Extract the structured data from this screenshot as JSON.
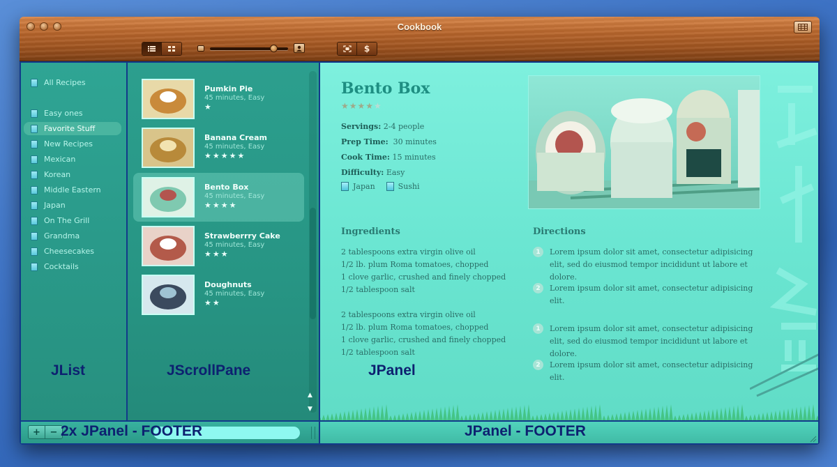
{
  "window": {
    "title": "Cookbook"
  },
  "toolbar": {
    "view_modes": [
      "list-view-icon",
      "grid-view-icon"
    ],
    "zoom_level": 0.82,
    "actions": [
      "fullscreen-icon",
      "dollar-icon"
    ]
  },
  "sidebar": {
    "items": [
      {
        "label": "All Recipes",
        "icon": "book-icon"
      },
      {
        "label": "Easy ones",
        "icon": "smart-folder-icon"
      },
      {
        "label": "Favorite Stuff",
        "icon": "smart-folder-icon",
        "selected": true
      },
      {
        "label": "New Recipes",
        "icon": "smart-folder-icon"
      },
      {
        "label": "Mexican",
        "icon": "folder-icon"
      },
      {
        "label": "Korean",
        "icon": "folder-icon"
      },
      {
        "label": "Middle Eastern",
        "icon": "folder-icon"
      },
      {
        "label": "Japan",
        "icon": "folder-icon"
      },
      {
        "label": "On The Grill",
        "icon": "folder-icon"
      },
      {
        "label": "Grandma",
        "icon": "folder-icon"
      },
      {
        "label": "Cheesecakes",
        "icon": "folder-icon"
      },
      {
        "label": "Cocktails",
        "icon": "folder-icon"
      }
    ]
  },
  "recipes": [
    {
      "name": "Pumkin Pie",
      "meta": "45 minutes, Easy",
      "stars": "★",
      "rating": 1
    },
    {
      "name": "Banana Cream",
      "meta": "45 minutes, Easy",
      "stars": "★★★★★",
      "rating": 5
    },
    {
      "name": "Bento Box",
      "meta": "45 minutes, Easy",
      "stars": "★★★★",
      "rating": 4,
      "selected": true
    },
    {
      "name": "Strawberrry Cake",
      "meta": "45 minutes, Easy",
      "stars": "★★★",
      "rating": 3
    },
    {
      "name": "Doughnuts",
      "meta": "45 minutes, Easy",
      "stars": "★★",
      "rating": 2
    }
  ],
  "labels": {
    "jlist": "JList",
    "jscrollpane": "JScrollPane",
    "jpanel": "JPanel",
    "footer_left": "2x JPanel - FOOTER",
    "footer_right": "JPanel - FOOTER"
  },
  "detail": {
    "title": "Bento Box",
    "stars_on": "★★★★",
    "stars_off": "★",
    "rating": 4,
    "servings_label": "Servings:",
    "servings": "2-4 people",
    "prep_label": "Prep Time:",
    "prep": "30 minutes",
    "cook_label": "Cook Time:",
    "cook": "15 minutes",
    "difficulty_label": "Difficulty:",
    "difficulty": "Easy",
    "tags": [
      "Japan",
      "Sushi"
    ],
    "ingredients_heading": "Ingredients",
    "ingredients": [
      "2 tablespoons extra virgin olive oil",
      "1/2 lb. plum Roma tomatoes, chopped",
      "1 clove garlic, crushed and finely chopped",
      "1/2 tablespoon salt",
      "",
      "2 tablespoons extra virgin olive oil",
      "1/2 lb. plum Roma tomatoes, chopped",
      "1 clove garlic, crushed and finely chopped",
      "1/2 tablespoon salt"
    ],
    "directions_heading": "Directions",
    "directions": [
      {
        "num": "1",
        "text": "Lorem ipsum dolor sit amet, consectetur adipisicing elit, sed do eiusmod tempor incididunt ut labore et dolore."
      },
      {
        "num": "2",
        "text": "Lorem ipsum dolor sit amet, consectetur adipisicing elit."
      },
      {
        "num": "1",
        "text": "Lorem ipsum dolor sit amet, consectetur adipisicing elit, sed do eiusmod tempor incididunt ut labore et dolore."
      },
      {
        "num": "2",
        "text": "Lorem ipsum dolor sit amet, consectetur adipisicing elit."
      }
    ]
  },
  "footer": {
    "add_label": "+",
    "remove_label": "−"
  },
  "colors": {
    "accent": "#1e8e82",
    "label_blue": "#0d2170",
    "wood": "#9f5420"
  }
}
